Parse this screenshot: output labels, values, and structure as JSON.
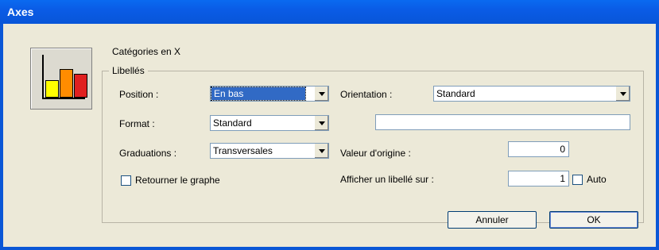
{
  "window": {
    "title": "Axes"
  },
  "caption": "Catégories en X",
  "group_label": "Libellés",
  "position": {
    "label": "Position :",
    "value": "En bas"
  },
  "format": {
    "label": "Format :",
    "value": "Standard"
  },
  "graduations": {
    "label": "Graduations :",
    "value": "Transversales"
  },
  "orientation": {
    "label": "Orientation :",
    "value": "Standard"
  },
  "format_text": "",
  "origin": {
    "label": "Valeur d'origine :",
    "value": "0"
  },
  "label_every": {
    "label": "Afficher un libellé sur :",
    "value": "1"
  },
  "auto": {
    "label": "Auto",
    "checked": false
  },
  "flip": {
    "label": "Retourner le graphe",
    "checked": false
  },
  "buttons": {
    "cancel": "Annuler",
    "ok": "OK"
  },
  "icon": {
    "name": "bar-chart-icon",
    "colors": [
      "#ffff00",
      "#ff8c00",
      "#e02020"
    ]
  }
}
